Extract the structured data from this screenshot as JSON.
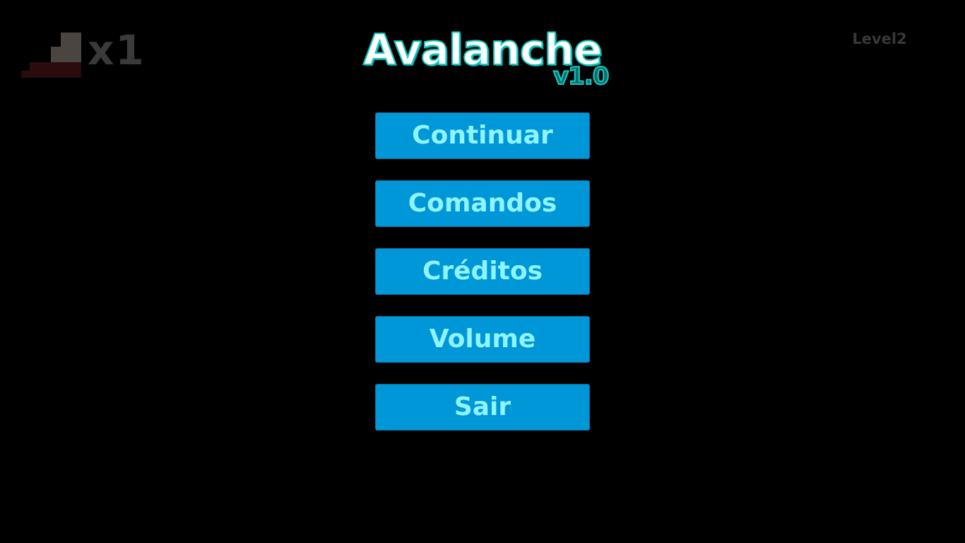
{
  "hud": {
    "lives_icon": "stairs-icon",
    "lives_count": "x1",
    "level": "Level2"
  },
  "title": {
    "name": "Avalanche",
    "version": "v1.0"
  },
  "menu": {
    "items": [
      {
        "label": "Continuar"
      },
      {
        "label": "Comandos"
      },
      {
        "label": "Créditos"
      },
      {
        "label": "Volume"
      },
      {
        "label": "Sair"
      }
    ]
  },
  "colors": {
    "background": "#000000",
    "button": "#0097d8",
    "button_text": "#8ef4ff",
    "title_outline": "#16c9c2",
    "hud_text": "#3a3a3a",
    "stairs_dark": "#2a0a0a",
    "stairs_light": "#4a4540"
  }
}
